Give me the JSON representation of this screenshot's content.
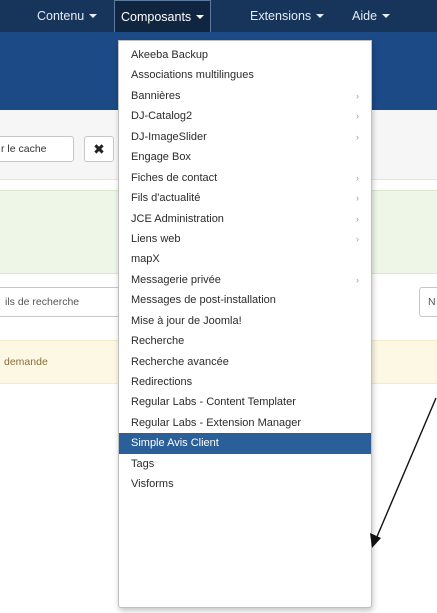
{
  "navbar": {
    "items": [
      {
        "label": "Contenu"
      },
      {
        "label": "Composants"
      },
      {
        "label": "Extensions"
      },
      {
        "label": "Aide"
      }
    ]
  },
  "toolbar": {
    "clear_cache_label": "r le cache",
    "close_label": "✖"
  },
  "search": {
    "field_fragment": "ils de recherche",
    "right_fragment": "N"
  },
  "notice": {
    "text": "demande"
  },
  "menu": {
    "items": [
      {
        "label": "Akeeba Backup",
        "has_submenu": false
      },
      {
        "label": "Associations multilingues",
        "has_submenu": false
      },
      {
        "label": "Bannières",
        "has_submenu": true
      },
      {
        "label": "DJ-Catalog2",
        "has_submenu": true
      },
      {
        "label": "DJ-ImageSlider",
        "has_submenu": true
      },
      {
        "label": "Engage Box",
        "has_submenu": false
      },
      {
        "label": "Fiches de contact",
        "has_submenu": true
      },
      {
        "label": "Fils d'actualité",
        "has_submenu": true
      },
      {
        "label": "JCE Administration",
        "has_submenu": true
      },
      {
        "label": "Liens web",
        "has_submenu": true
      },
      {
        "label": "mapX",
        "has_submenu": false
      },
      {
        "label": "Messagerie privée",
        "has_submenu": true
      },
      {
        "label": "Messages de post-installation",
        "has_submenu": false
      },
      {
        "label": "Mise à jour de Joomla!",
        "has_submenu": false
      },
      {
        "label": "Recherche",
        "has_submenu": false
      },
      {
        "label": "Recherche avancée",
        "has_submenu": false
      },
      {
        "label": "Redirections",
        "has_submenu": false
      },
      {
        "label": "Regular Labs - Content Templater",
        "has_submenu": false
      },
      {
        "label": "Regular Labs - Extension Manager",
        "has_submenu": false
      },
      {
        "label": "Simple Avis Client",
        "has_submenu": false,
        "highlighted": true
      },
      {
        "label": "Tags",
        "has_submenu": false
      },
      {
        "label": "Visforms",
        "has_submenu": false
      }
    ]
  },
  "icons": {
    "submenu_arrow": "chevron-right-icon",
    "nav_caret": "caret-down-icon"
  },
  "colors": {
    "navbar_bg": "#17345a",
    "header_bg": "#1c4a86",
    "highlight_bg": "#2a5f99",
    "success_bg": "#eef6e8",
    "warning_bg": "#fcf8e3"
  }
}
